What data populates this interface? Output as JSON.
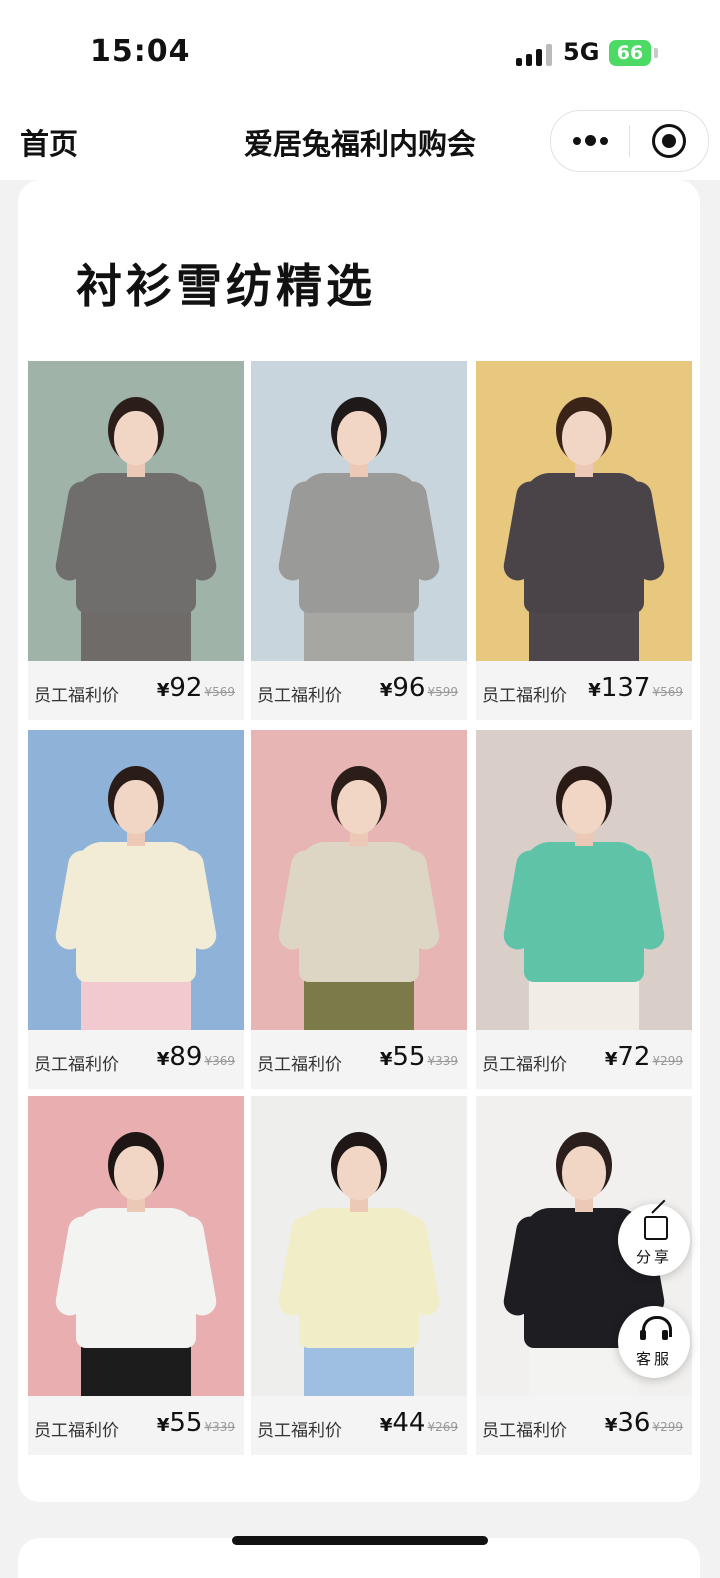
{
  "status_bar": {
    "time": "15:04",
    "network": "5G",
    "battery": "66"
  },
  "nav": {
    "home_label": "首页",
    "title": "爱居兔福利内购会"
  },
  "section": {
    "title": "衬衫雪纺精选"
  },
  "products": [
    {
      "label": "员工福利价",
      "currency": "¥",
      "price": "92",
      "original_price": "¥569",
      "colors": {
        "bg": "#9fb3a8",
        "top": "#6f6e6c",
        "bottom": "#6e6b68",
        "hair": "#2a1d1a"
      }
    },
    {
      "label": "员工福利价",
      "currency": "¥",
      "price": "96",
      "original_price": "¥599",
      "colors": {
        "bg": "#c9d5dc",
        "top": "#9a9a98",
        "bottom": "#a6a6a2",
        "hair": "#1f1a19"
      }
    },
    {
      "label": "员工福利价",
      "currency": "¥",
      "price": "137",
      "original_price": "¥569",
      "colors": {
        "bg": "#e8c77f",
        "top": "#4a4448",
        "bottom": "#4d474b",
        "hair": "#3a2418"
      }
    },
    {
      "label": "员工福利价",
      "currency": "¥",
      "price": "89",
      "original_price": "¥369",
      "colors": {
        "bg": "#8fb2d9",
        "top": "#f2ecd6",
        "bottom": "#f1c9cf",
        "hair": "#2a1c18"
      }
    },
    {
      "label": "员工福利价",
      "currency": "¥",
      "price": "55",
      "original_price": "¥339",
      "colors": {
        "bg": "#e7b6b4",
        "top": "#ddd6c4",
        "bottom": "#7d7a4a",
        "hair": "#2d1d18"
      }
    },
    {
      "label": "员工福利价",
      "currency": "¥",
      "price": "72",
      "original_price": "¥299",
      "colors": {
        "bg": "#d9cfc8",
        "top": "#5fc3a8",
        "bottom": "#f1ece4",
        "hair": "#2a1b17"
      }
    },
    {
      "label": "员工福利价",
      "currency": "¥",
      "price": "55",
      "original_price": "¥339",
      "colors": {
        "bg": "#e8aeb0",
        "top": "#f3f3f1",
        "bottom": "#1c1c1c",
        "hair": "#1e1614"
      }
    },
    {
      "label": "员工福利价",
      "currency": "¥",
      "price": "44",
      "original_price": "¥269",
      "colors": {
        "bg": "#eeeeec",
        "top": "#f1edc7",
        "bottom": "#9fbfe0",
        "hair": "#1e1715"
      }
    },
    {
      "label": "员工福利价",
      "currency": "¥",
      "price": "36",
      "original_price": "¥299",
      "colors": {
        "bg": "#f1f0ef",
        "top": "#1e1e22",
        "bottom": "#f3f3f1",
        "hair": "#2a1f1c"
      }
    }
  ],
  "floating": {
    "share_label": "分享",
    "service_label": "客服"
  }
}
